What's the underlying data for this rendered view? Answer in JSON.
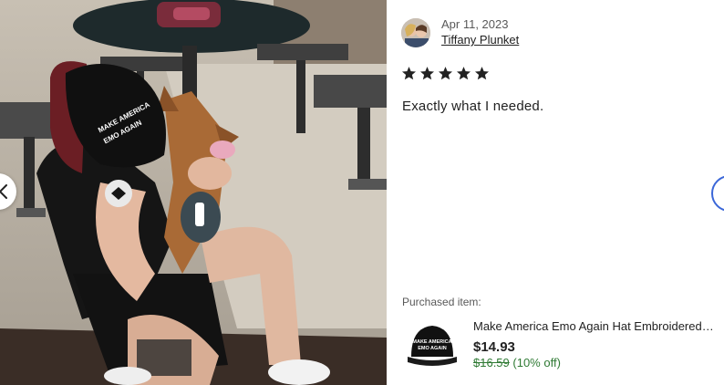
{
  "review": {
    "date": "Apr 11, 2023",
    "reviewer_name": "Tiffany Plunket",
    "rating": 5,
    "text": "Exactly what I needed."
  },
  "photo": {
    "hat_text_line1": "MAKE AMERICA",
    "hat_text_line2": "EMO AGAIN"
  },
  "purchased": {
    "label": "Purchased item:",
    "title": "Make America Emo Again Hat Embroidered Baseball Cap",
    "price": "$14.93",
    "original_price": "$16.59",
    "discount": "(10% off)",
    "thumb_text_line1": "MAKE AMERICA",
    "thumb_text_line2": "EMO AGAIN"
  },
  "colors": {
    "star": "#222222",
    "sale_green": "#2f7a34",
    "nav_accent": "#3b67d8"
  },
  "icons": {
    "prev": "chevron-left-icon",
    "next": "chevron-right-icon",
    "star": "star-icon"
  }
}
